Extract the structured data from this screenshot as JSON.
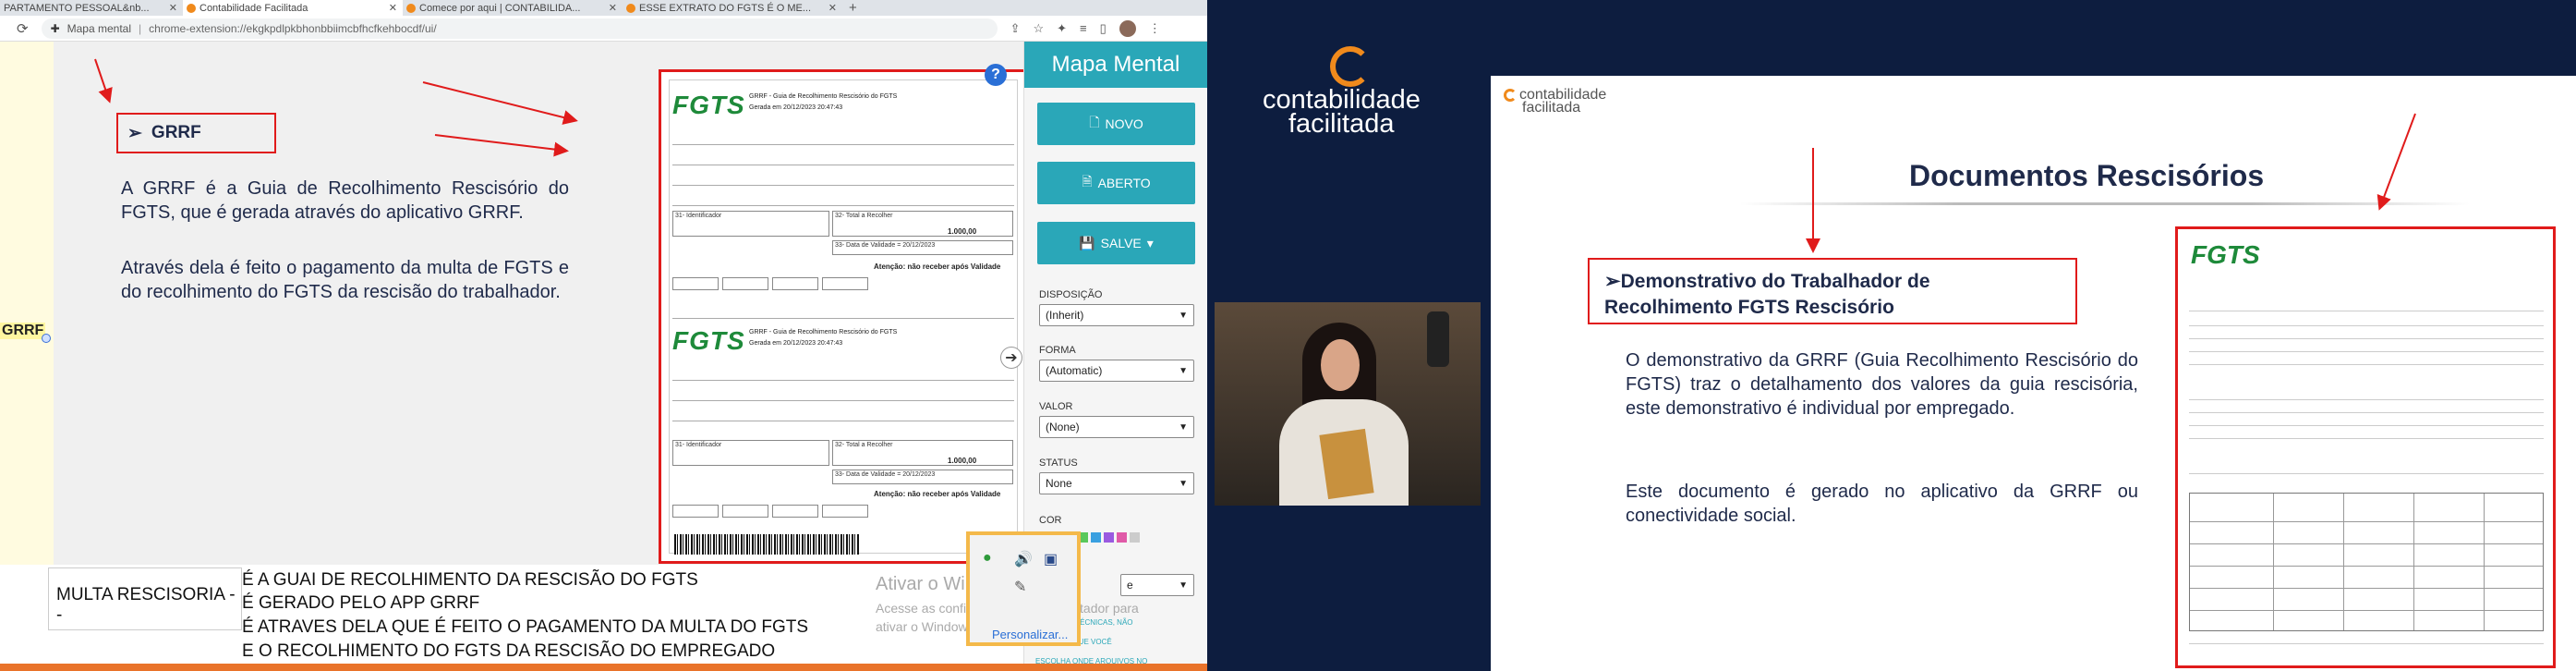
{
  "browser": {
    "tabs": [
      {
        "label": "PARTAMENTO PESSOAL&nb...",
        "active": false
      },
      {
        "label": "Contabilidade Facilitada",
        "active": true
      },
      {
        "label": "Comece por aqui | CONTABILIDA...",
        "active": false
      },
      {
        "label": "ESSE EXTRATO DO FGTS É O ME...",
        "active": false
      }
    ],
    "omnibox": {
      "extension_label": "Mapa mental",
      "url": "chrome-extension://ekgkpdlpkbhonbbiimcbfhcfkehbocdf/ui/"
    }
  },
  "left_slide": {
    "side_label": "GRRF",
    "box_title": "GRRF",
    "paragraph1": "A GRRF é a Guia de Recolhimento Rescisório  do FGTS, que é gerada através do aplicativo  GRRF.",
    "paragraph2": "Através dela é feito o pagamento da multa  de FGTS e do recolhimento do FGTS da  rescisão do trabalhador.",
    "doc": {
      "logo": "FGTS",
      "header_line1": "GRRF - Guia de Recolhimento Rescisório do FGTS",
      "header_line2": "Gerada em 20/12/2023 20:47:43",
      "identificador": "31- Identificador",
      "total": "32- Total a Recolher",
      "total_value": "1.000,00",
      "validade": "33- Data de Validade =  20/12/2023",
      "atencao": "Atenção: não receber após Validade"
    }
  },
  "mindmap": {
    "title": "Mapa Mental",
    "buttons": {
      "new": "NOVO",
      "open": "ABERTO",
      "save": "SALVE"
    },
    "fields": [
      {
        "label": "DISPOSIÇÃO",
        "value": "(Inherit)"
      },
      {
        "label": "FORMA",
        "value": "(Automatic)"
      },
      {
        "label": "VALOR",
        "value": "(None)"
      },
      {
        "label": "STATUS",
        "value": "None"
      }
    ],
    "color_label": "COR",
    "swatches": [
      "#e04b4b",
      "#f0a03a",
      "#f2e04a",
      "#5ac85a",
      "#3aa0e0",
      "#9a5ae0",
      "#e05aa8",
      "#cccccc"
    ],
    "last_select": "e",
    "note1": "MITAÇÕES TÉCNICAS, NÃO",
    "note2": "PERMITIR QUE VOCÊ",
    "note3": "ESCOLHA ONDE ARQUIVOS NO"
  },
  "bottom": {
    "left_label": "MULTA RESCISORIA --",
    "lines": [
      "É A GUAI DE RECOLHIMENTO  DA RESCISÃO  DO FGTS",
      "É GERADO PELO APP GRRF",
      "É ATRAVES DELA QUE É FEITO O PAGAMENTO DA MULTA DO FGTS",
      "E O RECOLHIMENTO  DO FGTS DA RESCISÃO DO EMPREGADO"
    ],
    "activate_title": "Ativar o Windows",
    "activate_text1": "Acesse as configurações do computador para",
    "activate_text2": "ativar o Windows.",
    "tray_link": "Personalizar..."
  },
  "video": {
    "brand_line1": "contabilidade",
    "brand_line2": "facilitada"
  },
  "right_slide": {
    "logo_line1": "contabilidade",
    "logo_line2": "facilitada",
    "title": "Documentos Rescisórios",
    "box_title": "Demonstrativo do Trabalhador de Recolhimento FGTS Rescisório",
    "paragraph1": "O demonstrativo da GRRF (Guia Recolhimento Rescisório do FGTS) traz o detalhamento dos valores da guia rescisória, este demonstrativo é individual por empregado.",
    "paragraph2": "Este documento é gerado no aplicativo da GRRF ou conectividade social.",
    "doc_logo": "FGTS"
  },
  "colors": {
    "accent_teal": "#2aa7b8",
    "highlight_red": "#e01b1b",
    "navy": "#1f2a4a",
    "brand_orange": "#f08a1c",
    "fgts_green": "#1e8a3a"
  }
}
